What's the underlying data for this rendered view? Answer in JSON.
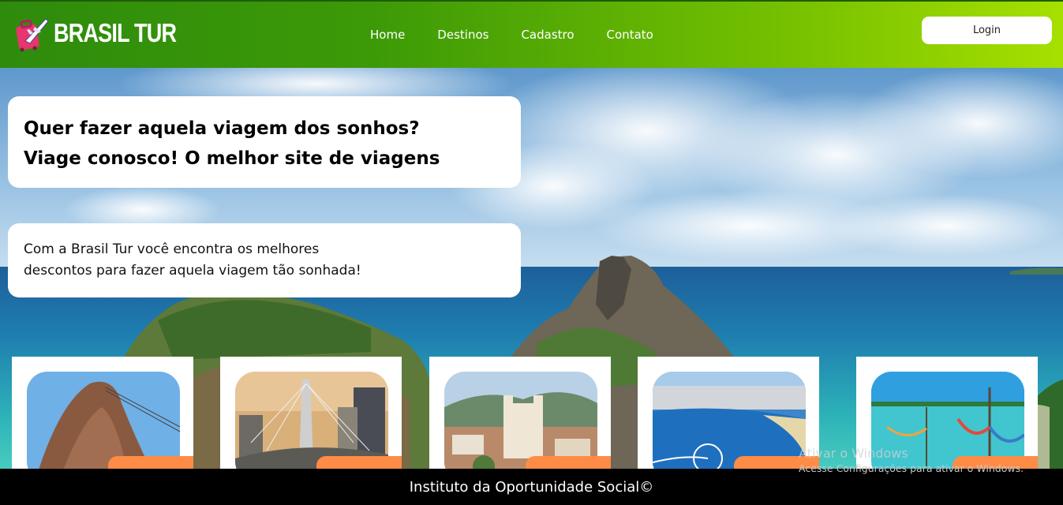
{
  "header": {
    "brand": "BRASIL TUR",
    "nav": [
      "Home",
      "Destinos",
      "Cadastro",
      "Contato"
    ],
    "login_label": "Login"
  },
  "hero": {
    "title_line1": "Quer fazer aquela viagem dos sonhos?",
    "title_line2": "Viage conosco! O melhor site de viagens",
    "desc_line1": "Com a Brasil Tur você encontra os melhores",
    "desc_line2": "descontos para fazer aquela viagem tão sonhada!"
  },
  "destinations": [
    {
      "image": "sugarloaf-mountain-photo"
    },
    {
      "image": "sao-paulo-bridge-photo"
    },
    {
      "image": "ouro-preto-church-photo"
    },
    {
      "image": "balneario-camboriu-beach-photo"
    },
    {
      "image": "hammock-lagoon-photo"
    }
  ],
  "footer": {
    "text": "Instituto da Oportunidade Social©"
  },
  "watermark": {
    "line1": "Ativar o Windows",
    "line2": "Acesse Configurações para ativar o Windows."
  },
  "colors": {
    "header_start": "#2e8b0c",
    "header_end": "#a6e000",
    "price_tag": "#ff8c46",
    "footer": "#000000"
  }
}
